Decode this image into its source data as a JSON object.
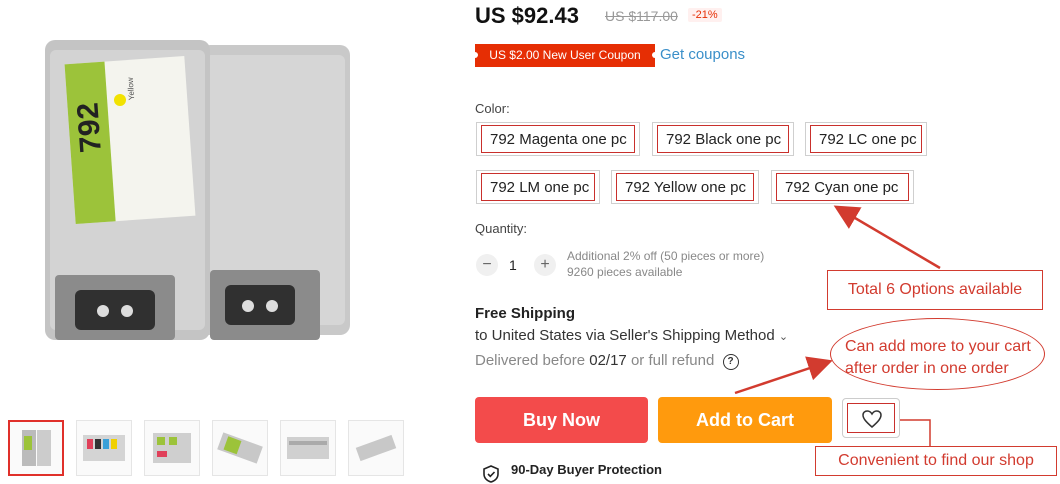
{
  "price": {
    "current": "US $92.43",
    "original": "US $117.00",
    "discount": "-21%"
  },
  "coupon": {
    "text": "US $2.00 New User Coupon",
    "link": "Get coupons"
  },
  "color": {
    "label": "Color:",
    "options": [
      "792 Magenta one pc",
      "792 Black one pc",
      "792 LC one pc",
      "792 LM one pc",
      "792 Yellow one pc",
      "792 Cyan one pc"
    ]
  },
  "quantity": {
    "label": "Quantity:",
    "value": "1",
    "minus": "−",
    "plus": "+",
    "note1": "Additional 2% off (50 pieces or more)",
    "note2": "9260 pieces available"
  },
  "shipping": {
    "title": "Free Shipping",
    "to": "to United States via Seller's Shipping Method",
    "delivered_pre": "Delivered before",
    "delivered_date": "02/17",
    "delivered_post": "or full refund",
    "help": "?"
  },
  "actions": {
    "buy": "Buy Now",
    "cart": "Add to Cart"
  },
  "protection": "90-Day Buyer Protection",
  "product_label": {
    "model": "792",
    "color_word": "Yellow"
  },
  "annotations": {
    "options": "Total 6 Options available",
    "cart_line1": "Can add more to your cart",
    "cart_line2": "after order in one order",
    "shop": "Convenient to find our shop"
  },
  "colors": {
    "accent": "#e62e04",
    "buy": "#f34b4b",
    "cart": "#ff9a0d",
    "annotation": "#d23b2f",
    "link": "#3a8fc9"
  }
}
